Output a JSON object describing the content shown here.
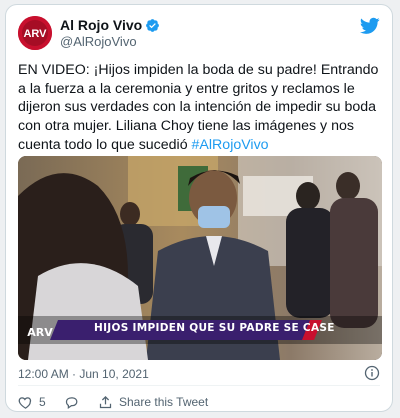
{
  "author": {
    "name": "Al Rojo Vivo",
    "handle": "@AlRojoVivo",
    "avatar_label": "ARV",
    "verified_icon": "verified-badge-icon"
  },
  "tweet": {
    "text": "EN VIDEO: ¡Hijos impiden la boda de su padre! Entrando a la fuerza a la ceremonia y entre gritos y reclamos le dijeron sus verdades con la intención de impedir su boda con otra mujer. Liliana Choy tiene las imágenes y nos cuenta todo lo que sucedió ",
    "hashtag": "#AlRojoVivo"
  },
  "media": {
    "banner_text": "HIJOS IMPIDEN QUE SU PADRE SE CASE",
    "logo_text": "ARV"
  },
  "meta": {
    "timestamp": "12:00 AM · Jun 10, 2021"
  },
  "actions": {
    "like_count": "5",
    "share_label": "Share this Tweet"
  },
  "colors": {
    "accent": "#1d9bf0",
    "brand_red": "#c8102e",
    "banner_purple": "#3a1f6e"
  }
}
